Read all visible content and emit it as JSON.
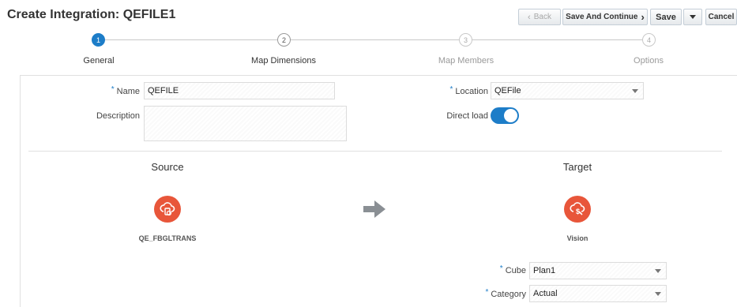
{
  "header": {
    "title": "Create Integration: QEFILE1",
    "back_label": "Back",
    "save_continue_label": "Save And Continue",
    "save_label": "Save",
    "cancel_label": "Cancel"
  },
  "train": {
    "steps": [
      {
        "number": "1",
        "label": "General",
        "state": "active"
      },
      {
        "number": "2",
        "label": "Map Dimensions",
        "state": "visited"
      },
      {
        "number": "3",
        "label": "Map Members",
        "state": "pending"
      },
      {
        "number": "4",
        "label": "Options",
        "state": "pending"
      }
    ]
  },
  "form": {
    "name_label": "Name",
    "name_value": "QEFILE",
    "description_label": "Description",
    "description_value": "",
    "location_label": "Location",
    "location_value": "QEFile",
    "direct_load_label": "Direct load",
    "direct_load_on": true
  },
  "source": {
    "heading": "Source",
    "app_name": "QE_FBGLTRANS",
    "icon": "cloud-file-icon"
  },
  "target": {
    "heading": "Target",
    "app_name": "Vision",
    "icon": "cloud-dollar-icon",
    "cube_label": "Cube",
    "cube_value": "Plan1",
    "category_label": "Category",
    "category_value": "Actual"
  },
  "colors": {
    "accent": "#1d7dc8",
    "app_icon": "#e8563a",
    "arrow": "#8a8f94"
  }
}
